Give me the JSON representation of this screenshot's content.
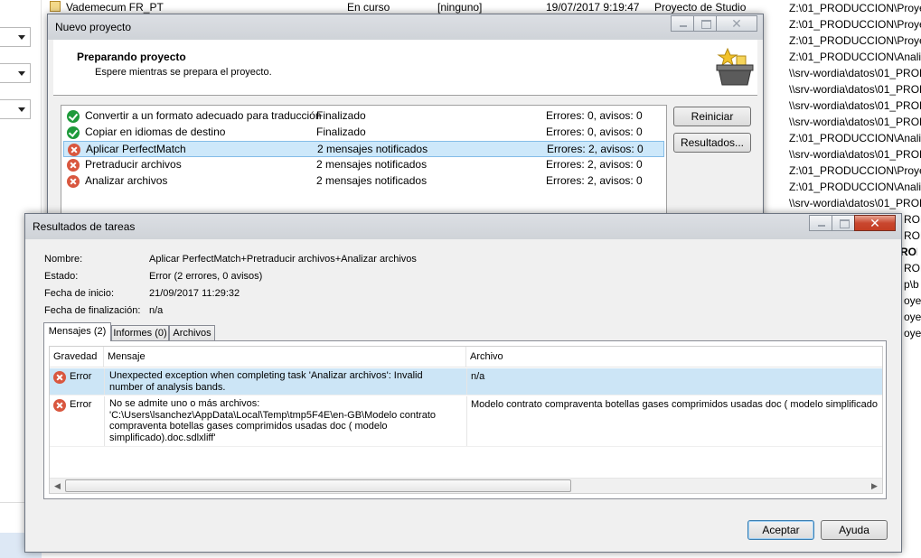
{
  "background": {
    "top_row": {
      "name": "Vademecum FR_PT",
      "status": "En curso",
      "client": "[ninguno]",
      "date": "19/07/2017 9:19:47",
      "type": "Proyecto de Studio"
    },
    "paths": [
      "Z:\\01_PRODUCCION\\Proyec",
      "Z:\\01_PRODUCCION\\Proyec",
      "Z:\\01_PRODUCCION\\Proyec",
      "Z:\\01_PRODUCCION\\Analisi",
      "\\\\srv-wordia\\datos\\01_PROD",
      "\\\\srv-wordia\\datos\\01_PROD",
      "\\\\srv-wordia\\datos\\01_PROD",
      "\\\\srv-wordia\\datos\\01_PROD",
      "Z:\\01_PRODUCCION\\Analisi",
      "\\\\srv-wordia\\datos\\01_PROD",
      "Z:\\01_PRODUCCION\\Proyec",
      "Z:\\01_PRODUCCION\\Analisi",
      "\\\\srv-wordia\\datos\\01_PROD"
    ],
    "partial_right": [
      "ROD",
      "ROD",
      "ROD",
      "ROD",
      "p\\b",
      "oyec",
      "oyec",
      "oyec"
    ]
  },
  "project_dialog": {
    "title": "Nuevo proyecto",
    "header_title": "Preparando proyecto",
    "header_subtitle": "Espere mientras se prepara el proyecto.",
    "tasks": [
      {
        "status": "ok",
        "name": "Convertir a un formato adecuado para traducción",
        "state": "Finalizado",
        "result": "Errores: 0, avisos: 0"
      },
      {
        "status": "ok",
        "name": "Copiar en idiomas de destino",
        "state": "Finalizado",
        "result": "Errores: 0, avisos: 0"
      },
      {
        "status": "error",
        "name": "Aplicar PerfectMatch",
        "state": "2 mensajes notificados",
        "result": "Errores: 2, avisos: 0",
        "selected": true
      },
      {
        "status": "error",
        "name": "Pretraducir archivos",
        "state": "2 mensajes notificados",
        "result": "Errores: 2, avisos: 0"
      },
      {
        "status": "error",
        "name": "Analizar archivos",
        "state": "2 mensajes notificados",
        "result": "Errores: 2, avisos: 0"
      }
    ],
    "restart_label": "Reiniciar",
    "results_label": "Resultados..."
  },
  "results_dialog": {
    "title": "Resultados de tareas",
    "fields": {
      "name_label": "Nombre:",
      "name_value": "Aplicar PerfectMatch+Pretraducir archivos+Analizar archivos",
      "state_label": "Estado:",
      "state_value": "Error (2 errores, 0 avisos)",
      "start_label": "Fecha de inicio:",
      "start_value": "21/09/2017 11:29:32",
      "end_label": "Fecha de finalización:",
      "end_value": "n/a"
    },
    "tabs": [
      "Mensajes (2)",
      "Informes (0)",
      "Archivos"
    ],
    "columns": [
      "Gravedad",
      "Mensaje",
      "Archivo"
    ],
    "rows": [
      {
        "severity": "Error",
        "message_lines": [
          "Unexpected exception when completing task 'Analizar archivos': Invalid",
          "number of analysis bands."
        ],
        "file": "n/a",
        "selected": true
      },
      {
        "severity": "Error",
        "message_lines": [
          "No se admite uno o más archivos:",
          "'C:\\Users\\lsanchez\\AppData\\Local\\Temp\\tmp5F4E\\en-GB\\Modelo contrato",
          "compraventa botellas gases comprimidos usadas doc ( modelo",
          "simplificado).doc.sdlxliff'"
        ],
        "file": "Modelo contrato compraventa botellas gases comprimidos usadas doc ( modelo simplificado"
      }
    ],
    "accept_label": "Aceptar",
    "help_label": "Ayuda"
  }
}
